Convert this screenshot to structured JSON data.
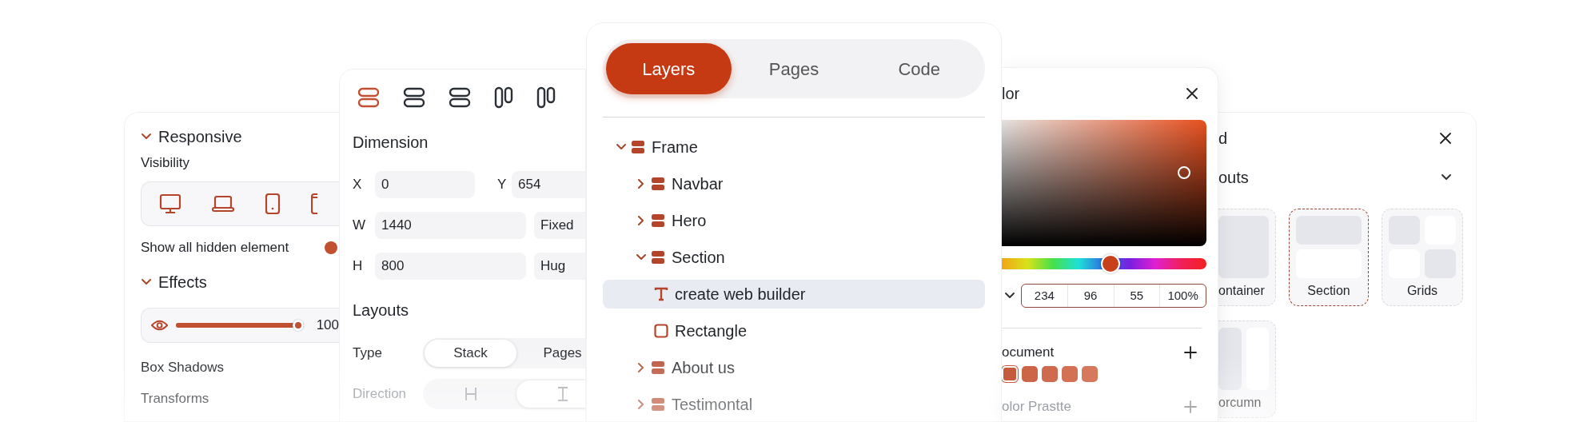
{
  "responsive_panel": {
    "responsive": {
      "title": "Responsive",
      "expanded": true
    },
    "visibility_label": "Visibility",
    "show_hidden": {
      "label": "Show all hidden element",
      "on": true
    },
    "effects": {
      "title": "Effects",
      "expanded": true
    },
    "opacity": {
      "level": 1,
      "reading": "100"
    },
    "items": [
      "Box Shadows",
      "Transforms"
    ]
  },
  "dimension_panel": {
    "align_icons": [
      {
        "kind": "rows",
        "selected": true
      },
      {
        "kind": "rows",
        "selected": false
      },
      {
        "kind": "rows",
        "selected": false
      },
      {
        "kind": "columns",
        "selected": false
      },
      {
        "kind": "columns",
        "selected": false
      }
    ],
    "title": "Dimension",
    "position": [
      {
        "label": "X",
        "value": "0"
      },
      {
        "label": "Y",
        "value": "654"
      }
    ],
    "size": [
      {
        "label": "W",
        "value": "1440",
        "mode": "Fixed"
      },
      {
        "label": "H",
        "value": "800",
        "mode": "Hug"
      }
    ],
    "layouts_title": "Layouts",
    "type": {
      "label": "Type",
      "options": [
        {
          "label": "Stack",
          "selected": true
        },
        {
          "label": "Pages",
          "selected": false
        }
      ]
    },
    "direction": {
      "label": "Direction",
      "options": [
        {
          "kind": "horizontal",
          "selected": false
        },
        {
          "kind": "vertical",
          "selected": true
        }
      ]
    }
  },
  "layers_panel": {
    "tabs": [
      {
        "label": "Layers",
        "selected": true
      },
      {
        "label": "Pages",
        "selected": false
      },
      {
        "label": "Code",
        "selected": false
      }
    ],
    "tree": [
      {
        "label": "Frame",
        "kind": "frame",
        "expanded": true,
        "selected": false,
        "children": [
          {
            "label": "Navbar",
            "kind": "frame",
            "expanded": false,
            "selected": false
          },
          {
            "label": "Hero",
            "kind": "frame",
            "expanded": false,
            "selected": false
          },
          {
            "label": "Section",
            "kind": "frame",
            "expanded": true,
            "selected": false,
            "children": [
              {
                "label": "create web builder",
                "kind": "text",
                "selected": true
              },
              {
                "label": "Rectangle",
                "kind": "rectangle",
                "selected": false
              }
            ]
          },
          {
            "label": "About us",
            "kind": "frame",
            "expanded": false,
            "selected": false
          },
          {
            "label": "Testimontal",
            "kind": "frame",
            "expanded": false,
            "selected": false
          }
        ]
      }
    ]
  },
  "color_panel": {
    "title": "lor",
    "hue": {
      "level": 0.53
    },
    "channels": [
      "234",
      "96",
      "55",
      "100%"
    ],
    "document": {
      "title": "ocument",
      "swatches": [
        {
          "color": "#c65a3d",
          "selected": true
        },
        {
          "color": "#cd6548",
          "selected": false
        },
        {
          "color": "#d06a4e",
          "selected": false
        },
        {
          "color": "#d27154",
          "selected": false
        },
        {
          "color": "#d5785c",
          "selected": false
        }
      ]
    },
    "palette": {
      "title": "olor Prastte"
    }
  },
  "layouts_panel": {
    "title": "d",
    "section": {
      "title": "outs",
      "expanded": true
    },
    "cards": [
      {
        "label": "ontainer",
        "kind": "container",
        "selected": false
      },
      {
        "label": "Section",
        "kind": "section",
        "selected": true
      },
      {
        "label": "Grids",
        "kind": "grids",
        "selected": false
      },
      {
        "label": "orcumn",
        "kind": "column",
        "selected": false
      }
    ]
  }
}
